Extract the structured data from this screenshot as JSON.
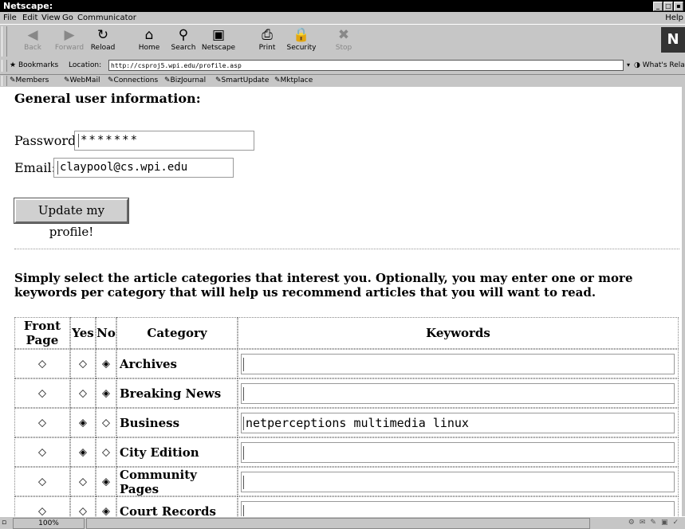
{
  "window": {
    "title": "Netscape:"
  },
  "menu": [
    "File",
    "Edit",
    "View",
    "Go",
    "Communicator",
    "Help"
  ],
  "toolbar": [
    {
      "label": "Back",
      "icon": "◀",
      "enabled": false
    },
    {
      "label": "Forward",
      "icon": "▶",
      "enabled": false
    },
    {
      "label": "Reload",
      "icon": "↻",
      "enabled": true
    },
    {
      "label": "Home",
      "icon": "⌂",
      "enabled": true
    },
    {
      "label": "Search",
      "icon": "⚲",
      "enabled": true
    },
    {
      "label": "Netscape",
      "icon": "▣",
      "enabled": true
    },
    {
      "label": "Print",
      "icon": "⎙",
      "enabled": true
    },
    {
      "label": "Security",
      "icon": "🔒",
      "enabled": true
    },
    {
      "label": "Stop",
      "icon": "✖",
      "enabled": false
    }
  ],
  "location": {
    "bookmarks": "Bookmarks",
    "label": "Location:",
    "url": "http://csproj5.wpi.edu/profile.asp",
    "related": "What's Related"
  },
  "personal": [
    "Members",
    "WebMail",
    "Connections",
    "BizJournal",
    "SmartUpdate",
    "Mktplace"
  ],
  "page": {
    "heading": "General user information:",
    "password_label": "Password:",
    "password_value": "*******",
    "email_label": "Email:",
    "email_value": "claypool@cs.wpi.edu",
    "update_button": "Update my profile!",
    "intro": "Simply select the article categories that interest you. Optionally, you may enter one or more keywords per category that will help us recommend articles that you will want to read."
  },
  "table": {
    "headers": [
      "Front Page",
      "Yes",
      "No",
      "Category",
      "Keywords"
    ],
    "rows": [
      {
        "category": "Archives",
        "selected": "No",
        "keywords": ""
      },
      {
        "category": "Breaking News",
        "selected": "No",
        "keywords": ""
      },
      {
        "category": "Business",
        "selected": "Yes",
        "keywords": "netperceptions multimedia linux"
      },
      {
        "category": "City Edition",
        "selected": "Yes",
        "keywords": ""
      },
      {
        "category": "Community Pages",
        "selected": "No",
        "keywords": ""
      },
      {
        "category": "Court Records",
        "selected": "No",
        "keywords": ""
      }
    ]
  },
  "status": {
    "zoom": "100%"
  }
}
